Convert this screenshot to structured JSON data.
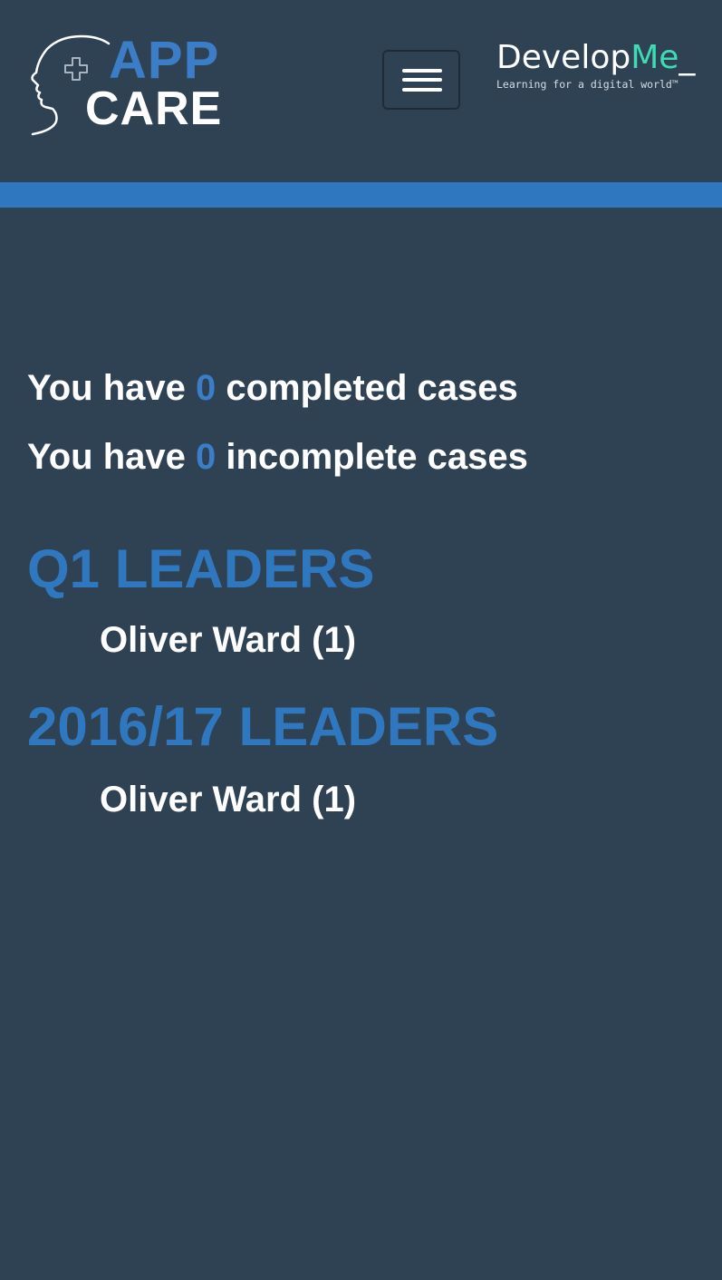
{
  "header": {
    "logo_app": "APP",
    "logo_care": "CARE",
    "menu_icon": "hamburger-icon",
    "brand": {
      "name_part1": "Develop",
      "name_part2": "Me",
      "name_cursor": "_",
      "tagline": "Learning for a digital world™"
    }
  },
  "colors": {
    "background": "#2f4254",
    "accent": "#2f78c0",
    "brand_green": "#3ddcb4"
  },
  "stats": {
    "completed": {
      "prefix": "You have ",
      "count": "0",
      "suffix": " completed cases"
    },
    "incomplete": {
      "prefix": "You have ",
      "count": "0",
      "suffix": " incomplete cases"
    }
  },
  "leaders": [
    {
      "title": "Q1 LEADERS",
      "entries": [
        "Oliver Ward (1)"
      ]
    },
    {
      "title": "2016/17 LEADERS",
      "entries": [
        "Oliver Ward (1)"
      ]
    }
  ]
}
